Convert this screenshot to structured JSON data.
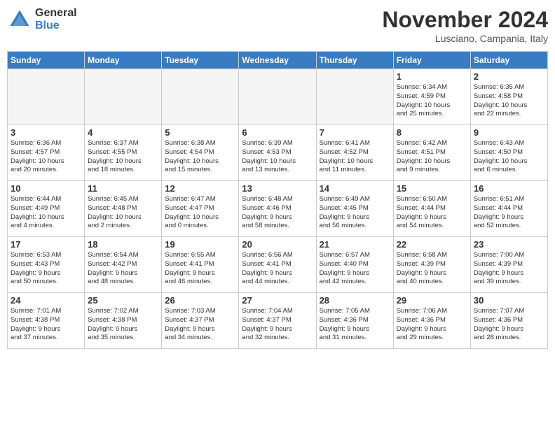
{
  "header": {
    "logo_general": "General",
    "logo_blue": "Blue",
    "month_title": "November 2024",
    "location": "Lusciano, Campania, Italy"
  },
  "days_of_week": [
    "Sunday",
    "Monday",
    "Tuesday",
    "Wednesday",
    "Thursday",
    "Friday",
    "Saturday"
  ],
  "weeks": [
    [
      {
        "day": "",
        "info": "",
        "empty": true
      },
      {
        "day": "",
        "info": "",
        "empty": true
      },
      {
        "day": "",
        "info": "",
        "empty": true
      },
      {
        "day": "",
        "info": "",
        "empty": true
      },
      {
        "day": "",
        "info": "",
        "empty": true
      },
      {
        "day": "1",
        "info": "Sunrise: 6:34 AM\nSunset: 4:59 PM\nDaylight: 10 hours\nand 25 minutes."
      },
      {
        "day": "2",
        "info": "Sunrise: 6:35 AM\nSunset: 4:58 PM\nDaylight: 10 hours\nand 22 minutes."
      }
    ],
    [
      {
        "day": "3",
        "info": "Sunrise: 6:36 AM\nSunset: 4:57 PM\nDaylight: 10 hours\nand 20 minutes."
      },
      {
        "day": "4",
        "info": "Sunrise: 6:37 AM\nSunset: 4:55 PM\nDaylight: 10 hours\nand 18 minutes."
      },
      {
        "day": "5",
        "info": "Sunrise: 6:38 AM\nSunset: 4:54 PM\nDaylight: 10 hours\nand 15 minutes."
      },
      {
        "day": "6",
        "info": "Sunrise: 6:39 AM\nSunset: 4:53 PM\nDaylight: 10 hours\nand 13 minutes."
      },
      {
        "day": "7",
        "info": "Sunrise: 6:41 AM\nSunset: 4:52 PM\nDaylight: 10 hours\nand 11 minutes."
      },
      {
        "day": "8",
        "info": "Sunrise: 6:42 AM\nSunset: 4:51 PM\nDaylight: 10 hours\nand 9 minutes."
      },
      {
        "day": "9",
        "info": "Sunrise: 6:43 AM\nSunset: 4:50 PM\nDaylight: 10 hours\nand 6 minutes."
      }
    ],
    [
      {
        "day": "10",
        "info": "Sunrise: 6:44 AM\nSunset: 4:49 PM\nDaylight: 10 hours\nand 4 minutes."
      },
      {
        "day": "11",
        "info": "Sunrise: 6:45 AM\nSunset: 4:48 PM\nDaylight: 10 hours\nand 2 minutes."
      },
      {
        "day": "12",
        "info": "Sunrise: 6:47 AM\nSunset: 4:47 PM\nDaylight: 10 hours\nand 0 minutes."
      },
      {
        "day": "13",
        "info": "Sunrise: 6:48 AM\nSunset: 4:46 PM\nDaylight: 9 hours\nand 58 minutes."
      },
      {
        "day": "14",
        "info": "Sunrise: 6:49 AM\nSunset: 4:45 PM\nDaylight: 9 hours\nand 56 minutes."
      },
      {
        "day": "15",
        "info": "Sunrise: 6:50 AM\nSunset: 4:44 PM\nDaylight: 9 hours\nand 54 minutes."
      },
      {
        "day": "16",
        "info": "Sunrise: 6:51 AM\nSunset: 4:44 PM\nDaylight: 9 hours\nand 52 minutes."
      }
    ],
    [
      {
        "day": "17",
        "info": "Sunrise: 6:53 AM\nSunset: 4:43 PM\nDaylight: 9 hours\nand 50 minutes."
      },
      {
        "day": "18",
        "info": "Sunrise: 6:54 AM\nSunset: 4:42 PM\nDaylight: 9 hours\nand 48 minutes."
      },
      {
        "day": "19",
        "info": "Sunrise: 6:55 AM\nSunset: 4:41 PM\nDaylight: 9 hours\nand 46 minutes."
      },
      {
        "day": "20",
        "info": "Sunrise: 6:56 AM\nSunset: 4:41 PM\nDaylight: 9 hours\nand 44 minutes."
      },
      {
        "day": "21",
        "info": "Sunrise: 6:57 AM\nSunset: 4:40 PM\nDaylight: 9 hours\nand 42 minutes."
      },
      {
        "day": "22",
        "info": "Sunrise: 6:58 AM\nSunset: 4:39 PM\nDaylight: 9 hours\nand 40 minutes."
      },
      {
        "day": "23",
        "info": "Sunrise: 7:00 AM\nSunset: 4:39 PM\nDaylight: 9 hours\nand 39 minutes."
      }
    ],
    [
      {
        "day": "24",
        "info": "Sunrise: 7:01 AM\nSunset: 4:38 PM\nDaylight: 9 hours\nand 37 minutes."
      },
      {
        "day": "25",
        "info": "Sunrise: 7:02 AM\nSunset: 4:38 PM\nDaylight: 9 hours\nand 35 minutes."
      },
      {
        "day": "26",
        "info": "Sunrise: 7:03 AM\nSunset: 4:37 PM\nDaylight: 9 hours\nand 34 minutes."
      },
      {
        "day": "27",
        "info": "Sunrise: 7:04 AM\nSunset: 4:37 PM\nDaylight: 9 hours\nand 32 minutes."
      },
      {
        "day": "28",
        "info": "Sunrise: 7:05 AM\nSunset: 4:36 PM\nDaylight: 9 hours\nand 31 minutes."
      },
      {
        "day": "29",
        "info": "Sunrise: 7:06 AM\nSunset: 4:36 PM\nDaylight: 9 hours\nand 29 minutes."
      },
      {
        "day": "30",
        "info": "Sunrise: 7:07 AM\nSunset: 4:36 PM\nDaylight: 9 hours\nand 28 minutes."
      }
    ]
  ]
}
